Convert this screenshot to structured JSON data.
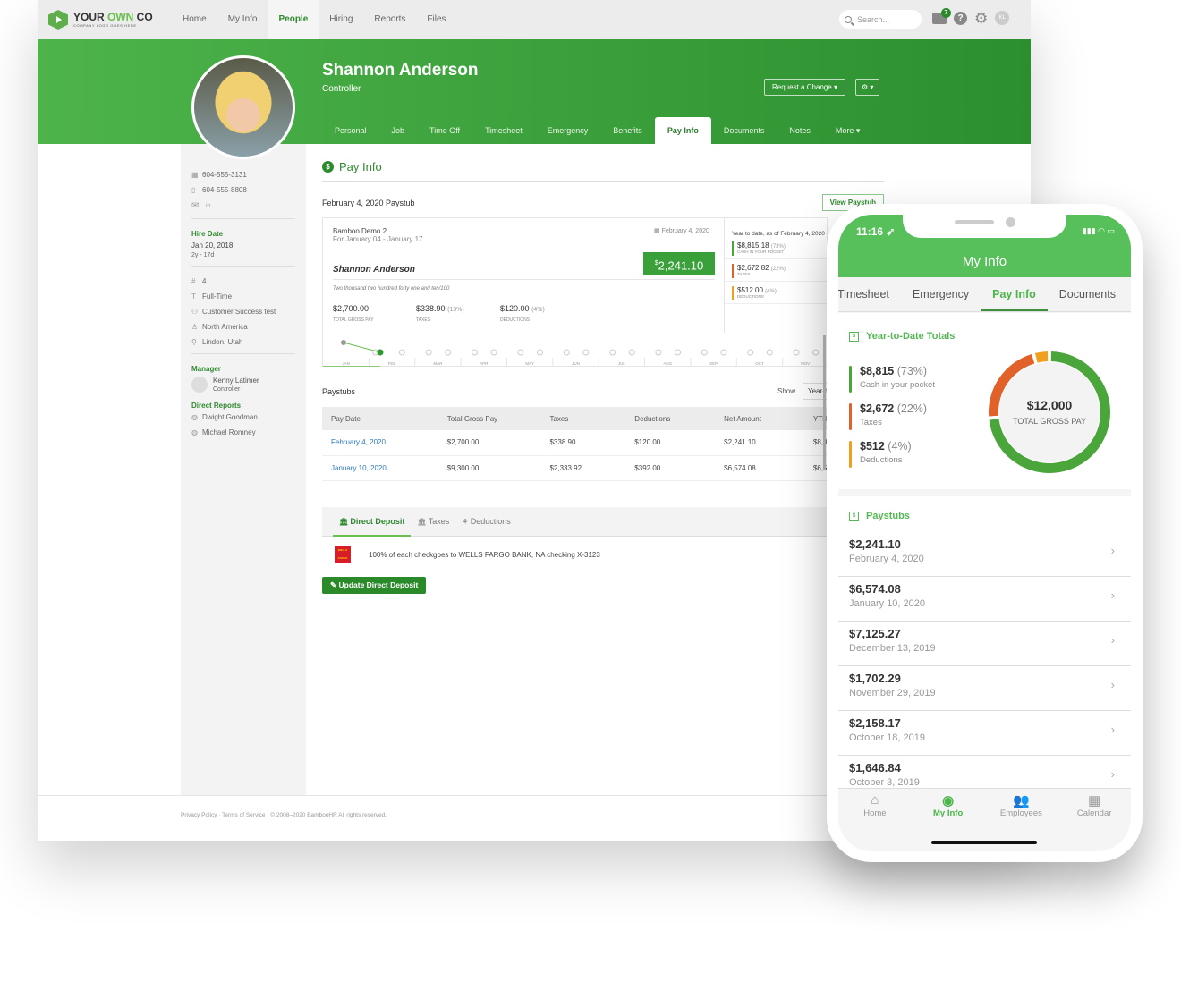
{
  "topnav": {
    "logo_main": "YOUR ",
    "logo_accent": "OWN",
    "logo_end": " CO",
    "logo_sub": "COMPANY LOGO GOES HERE",
    "items": [
      "Home",
      "My Info",
      "People",
      "Hiring",
      "Reports",
      "Files"
    ],
    "active": "People",
    "search_placeholder": "Search...",
    "inbox_count": "7",
    "avatar_initials": "KL"
  },
  "profile": {
    "name": "Shannon Anderson",
    "title": "Controller",
    "request_change": "Request a Change ▾",
    "gear": "⚙ ▾",
    "tabs": [
      "Personal",
      "Job",
      "Time Off",
      "Timesheet",
      "Emergency",
      "Benefits",
      "Pay Info",
      "Documents",
      "Notes",
      "More ▾"
    ],
    "active_tab": "Pay Info"
  },
  "sidebar": {
    "work_phone": "604-555-3131",
    "mobile_phone": "604-555-8808",
    "hire_date_label": "Hire Date",
    "hire_date": "Jan 20, 2018",
    "tenure": "2y - 17d",
    "employee_number": "4",
    "employment_status": "Full-Time",
    "department": "Customer Success test",
    "division": "North America",
    "location": "Lindon, Utah",
    "manager_label": "Manager",
    "manager_name": "Kenny Latimer",
    "manager_title": "Controller",
    "direct_reports_label": "Direct Reports",
    "direct_reports": [
      "Dwight Goodman",
      "Michael Romney"
    ]
  },
  "payinfo": {
    "heading": "Pay Info",
    "stub_title": "February 4, 2020 Paystub",
    "view_paystub": "View Paystub",
    "company": "Bamboo Demo 2",
    "period": "For January 04 - January 17",
    "pay_date": "February 4, 2020",
    "net_symbol": "$",
    "net": "2,241.10",
    "employee": "Shannon Anderson",
    "amount_words": "Two thousand two hundred forty one and ten/100",
    "gross": "$2,700.00",
    "gross_label": "TOTAL GROSS PAY",
    "taxes": "$338.90",
    "taxes_pct": "(13%)",
    "taxes_label": "TAXES",
    "deductions": "$120.00",
    "deductions_pct": "(4%)",
    "deductions_label": "DEDUCTIONS",
    "ytd_title": "Year to date, as of February 4, 2020",
    "ytd": [
      {
        "amount": "$8,815.18",
        "pct": "(73%)",
        "label": "CASH IN YOUR POCKET",
        "color": "#4aa53a"
      },
      {
        "amount": "$2,672.82",
        "pct": "(22%)",
        "label": "TAXES",
        "color": "#e0622a"
      },
      {
        "amount": "$512.00",
        "pct": "(4%)",
        "label": "DEDUCTIONS",
        "color": "#f0a020"
      }
    ],
    "months": [
      "JAN",
      "FEB",
      "MAR",
      "APR",
      "MAY",
      "JUN",
      "JUL",
      "AUG",
      "SEP",
      "OCT",
      "NOV"
    ]
  },
  "paystubs": {
    "title": "Paystubs",
    "show_label": "Show",
    "show_value": "Year-to-Date",
    "columns": [
      "Pay Date",
      "Total Gross Pay",
      "Taxes",
      "Deductions",
      "Net Amount",
      "YTD"
    ],
    "rows": [
      [
        "February 4, 2020",
        "$2,700.00",
        "$338.90",
        "$120.00",
        "$2,241.10",
        "$8,815.18"
      ],
      [
        "January 10, 2020",
        "$9,300.00",
        "$2,333.92",
        "$392.00",
        "$6,574.08",
        "$6,574.08"
      ]
    ]
  },
  "deposit": {
    "tabs": [
      "Direct Deposit",
      "Taxes",
      "Deductions"
    ],
    "bank_logo": "WELLS FARGO",
    "text_bold": "100% of each check",
    "text": " goes to WELLS FARGO BANK, NA checking X-3123",
    "update_button": "Update Direct Deposit"
  },
  "footer": {
    "text": "Privacy Policy · Terms of Service · © 2008–2020 BambooHR All rights reserved."
  },
  "phone": {
    "time": "11:16 ➶",
    "status": "▮▮▮ ◠ ▭",
    "title": "My Info",
    "tabs": [
      "Timesheet",
      "Emergency",
      "Pay Info",
      "Documents"
    ],
    "active_tab": "Pay Info",
    "ytd_heading": "Year-to-Date Totals",
    "ytd": [
      {
        "amount": "$8,815",
        "pct": "(73%)",
        "label": "Cash in your pocket",
        "color": "#4aa53a",
        "value": 8815
      },
      {
        "amount": "$2,672",
        "pct": "(22%)",
        "label": "Taxes",
        "color": "#e0622a",
        "value": 2672
      },
      {
        "amount": "$512",
        "pct": "(4%)",
        "label": "Deductions",
        "color": "#f0a020",
        "value": 512
      }
    ],
    "total": "$12,000",
    "total_label": "TOTAL GROSS PAY",
    "paystubs_heading": "Paystubs",
    "paystubs": [
      {
        "amount": "$2,241.10",
        "date": "February 4, 2020"
      },
      {
        "amount": "$6,574.08",
        "date": "January 10, 2020"
      },
      {
        "amount": "$7,125.27",
        "date": "December 13, 2019"
      },
      {
        "amount": "$1,702.29",
        "date": "November 29, 2019"
      },
      {
        "amount": "$2,158.17",
        "date": "October 18, 2019"
      },
      {
        "amount": "$1,646.84",
        "date": "October 3, 2019"
      }
    ],
    "nav": [
      {
        "label": "Home",
        "icon": "⌂"
      },
      {
        "label": "My Info",
        "icon": "◉"
      },
      {
        "label": "Employees",
        "icon": "👥"
      },
      {
        "label": "Calendar",
        "icon": "▦"
      }
    ],
    "nav_active": "My Info"
  }
}
